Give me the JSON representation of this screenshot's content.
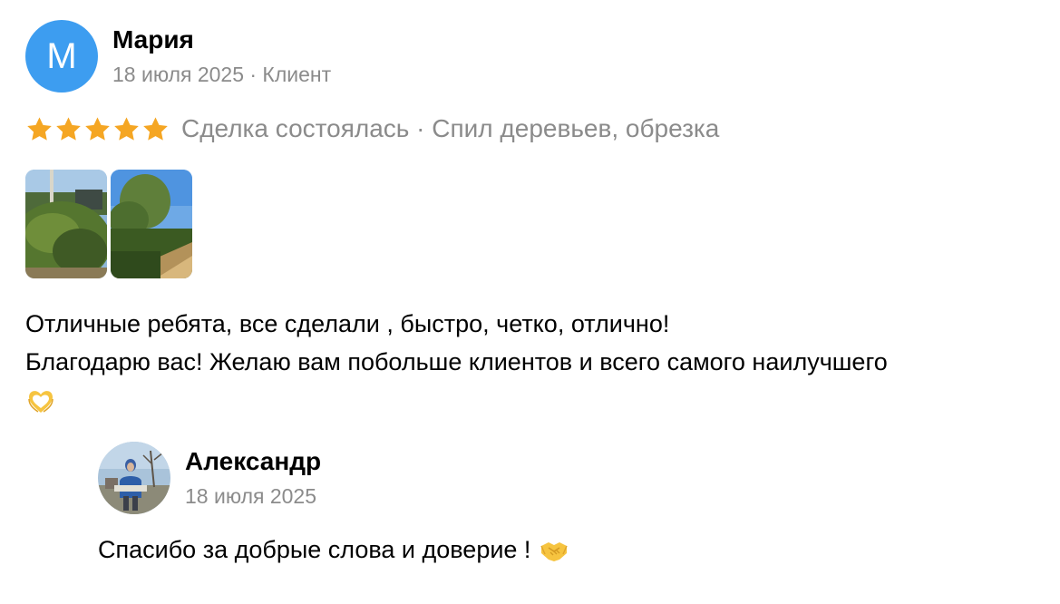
{
  "review": {
    "avatar_letter": "М",
    "author_name": "Мария",
    "meta": "18 июля 2025 · Клиент",
    "rating": 5,
    "rating_max": 5,
    "deal_info": "Сделка состоялась · Спил деревьев, обрезка",
    "text_line_1": "Отличные ребята, все сделали , быстро, четко, отлично!",
    "text_line_2": "Благодарю вас! Желаю вам побольше клиентов и всего самого наилучшего",
    "text_emoji": "heart-hands-icon",
    "colors": {
      "avatar_bg": "#3d9df0",
      "star": "#f5a623",
      "muted_text": "#8b8b8b"
    }
  },
  "reply": {
    "author_name": "Александр",
    "date": "18 июля 2025",
    "text": "Спасибо за добрые слова и доверие !",
    "text_emoji": "handshake-icon"
  }
}
